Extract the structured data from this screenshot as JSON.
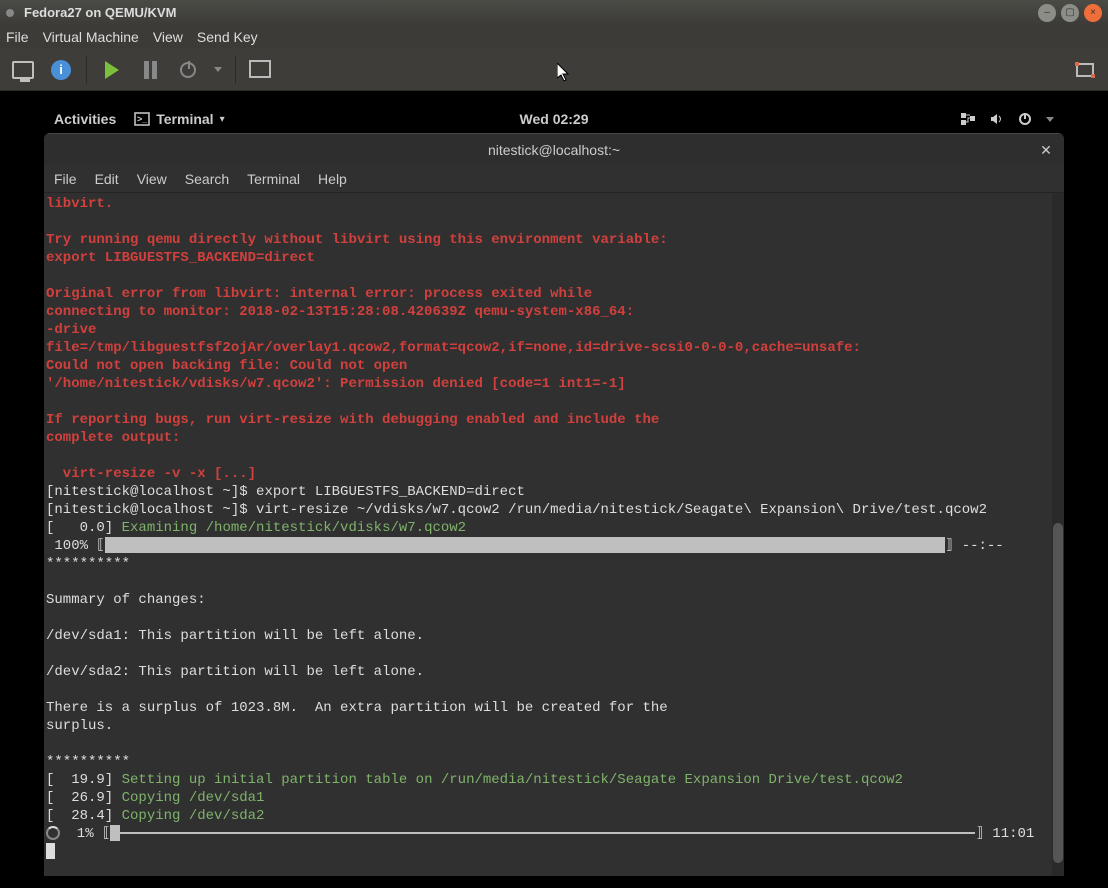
{
  "vm": {
    "title": "Fedora27 on QEMU/KVM",
    "menu": {
      "file": "File",
      "virtual_machine": "Virtual Machine",
      "view": "View",
      "sendkey": "Send Key"
    }
  },
  "gnome": {
    "activities": "Activities",
    "app_label": "Terminal",
    "clock": "Wed 02:29"
  },
  "terminal": {
    "title": "nitestick@localhost:~",
    "menu": {
      "file": "File",
      "edit": "Edit",
      "view": "View",
      "search": "Search",
      "terminal": "Terminal",
      "help": "Help"
    },
    "lines": {
      "l1": "libvirt.",
      "l2": "",
      "l3": "Try running qemu directly without libvirt using this environment variable:",
      "l4": "export LIBGUESTFS_BACKEND=direct",
      "l5": "",
      "l6": "Original error from libvirt: internal error: process exited while",
      "l7": "connecting to monitor: 2018-02-13T15:28:08.420639Z qemu-system-x86_64:",
      "l8": "-drive",
      "l9": "file=/tmp/libguestfsf2ojAr/overlay1.qcow2,format=qcow2,if=none,id=drive-scsi0-0-0-0,cache=unsafe:",
      "l10": "Could not open backing file: Could not open",
      "l11": "'/home/nitestick/vdisks/w7.qcow2': Permission denied [code=1 int1=-1]",
      "l12": "",
      "l13": "If reporting bugs, run virt-resize with debugging enabled and include the",
      "l14": "complete output:",
      "l15": "",
      "l16": "  virt-resize -v -x [...]",
      "p1": "[nitestick@localhost ~]$ ",
      "c1": "export LIBGUESTFS_BACKEND=direct",
      "p2": "[nitestick@localhost ~]$ ",
      "c2": "virt-resize ~/vdisks/w7.qcow2 /run/media/nitestick/Seagate\\ Expansion\\ Drive/test.qcow2",
      "t0": "[   0.0] ",
      "m0": "Examining /home/nitestick/vdisks/w7.qcow2",
      "pct100": " 100% ",
      "eta1": " --:--",
      "stars1": "**********",
      "sum": "Summary of changes:",
      "sda1": "/dev/sda1: This partition will be left alone.",
      "sda2": "/dev/sda2: This partition will be left alone.",
      "surplus1": "There is a surplus of 1023.8M.  An extra partition will be created for the",
      "surplus2": "surplus.",
      "stars2": "**********",
      "t19": "[  19.9] ",
      "m19": "Setting up initial partition table on /run/media/nitestick/Seagate Expansion Drive/test.qcow2",
      "t26": "[  26.9] ",
      "m26": "Copying /dev/sda1",
      "t28": "[  28.4] ",
      "m28": "Copying /dev/sda2",
      "pct1": "  1% ",
      "eta2": " 11:01"
    }
  }
}
